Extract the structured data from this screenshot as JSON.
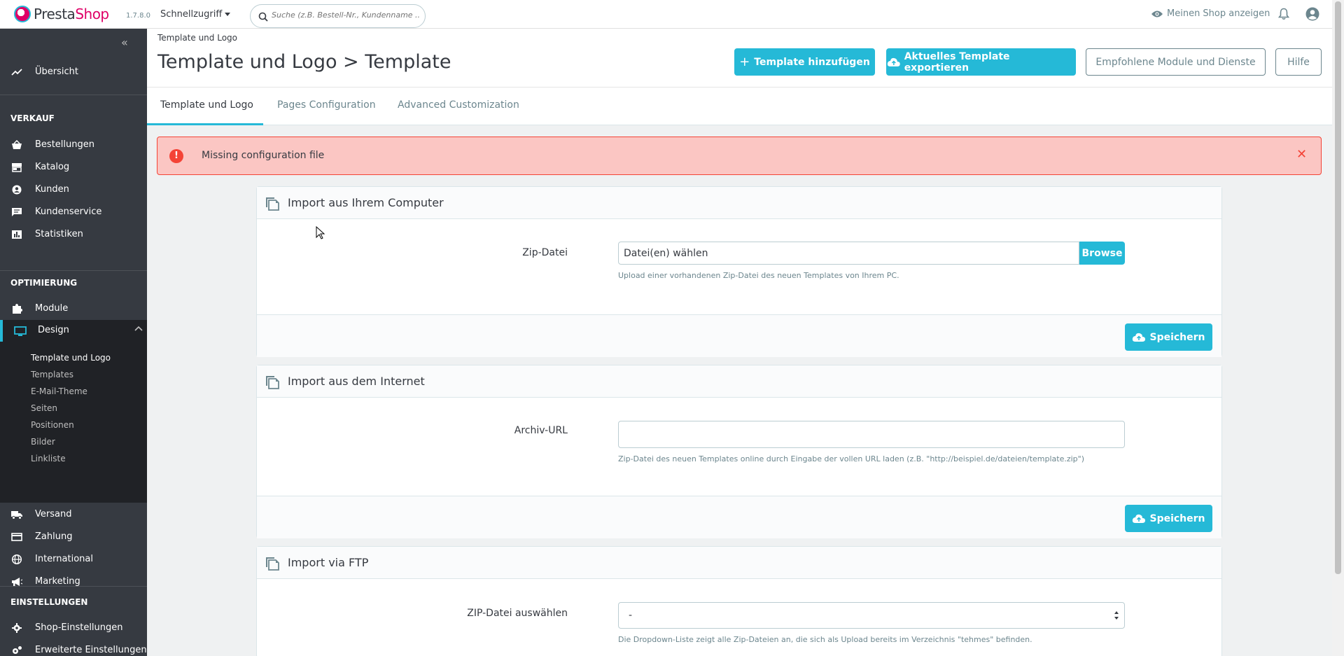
{
  "header": {
    "logo_part1": "Presta",
    "logo_part2": "Shop",
    "version": "1.7.8.0",
    "quick_access": "Schnellzugriff",
    "search_placeholder": "Suche (z.B. Bestell-Nr., Kundenname ...",
    "show_shop": "Meinen Shop anzeigen"
  },
  "sidebar": {
    "overview": "Übersicht",
    "sections": {
      "sell": "VERKAUF",
      "improve": "OPTIMIERUNG",
      "configure": "EINSTELLUNGEN"
    },
    "sell_items": [
      "Bestellungen",
      "Katalog",
      "Kunden",
      "Kundenservice",
      "Statistiken"
    ],
    "improve_items": {
      "modules": "Module",
      "design": "Design",
      "design_sub": [
        "Template und Logo",
        "Templates",
        "E-Mail-Theme",
        "Seiten",
        "Positionen",
        "Bilder",
        "Linkliste"
      ],
      "after": [
        "Versand",
        "Zahlung",
        "International",
        "Marketing"
      ]
    },
    "configure_items": [
      "Shop-Einstellungen",
      "Erweiterte Einstellungen"
    ]
  },
  "page": {
    "breadcrumb": "Template und Logo",
    "title": "Template und Logo > Template",
    "toolbar": {
      "add": "Template hinzufügen",
      "export": "Aktuelles Template exportieren",
      "recommended": "Empfohlene Module und Dienste",
      "help": "Hilfe"
    },
    "tabs": [
      "Template und Logo",
      "Pages Configuration",
      "Advanced Customization"
    ]
  },
  "alert": {
    "message": "Missing configuration file"
  },
  "panels": {
    "computer": {
      "title": "Import aus Ihrem Computer",
      "label": "Zip-Datei",
      "file_value": "Datei(en) wählen",
      "browse": "Browse",
      "help": "Upload einer vorhandenen Zip-Datei des neuen Templates von Ihrem PC.",
      "save": "Speichern"
    },
    "internet": {
      "title": "Import aus dem Internet",
      "label": "Archiv-URL",
      "value": "",
      "help": "Zip-Datei des neuen Templates online durch Eingabe der vollen URL laden (z.B. \"http://beispiel.de/dateien/template.zip\")",
      "save": "Speichern"
    },
    "ftp": {
      "title": "Import via FTP",
      "label": "ZIP-Datei auswählen",
      "selected": "-",
      "help": "Die Dropdown-Liste zeigt alle Zip-Dateien an, die sich als Upload bereits im Verzeichnis \"tehmes\" befinden."
    }
  },
  "colors": {
    "accent": "#25b9d7",
    "sidebar": "#363a41",
    "alert_bg": "#fbc6c3",
    "alert_icon": "#f44336",
    "brand_pink": "#df0067"
  }
}
